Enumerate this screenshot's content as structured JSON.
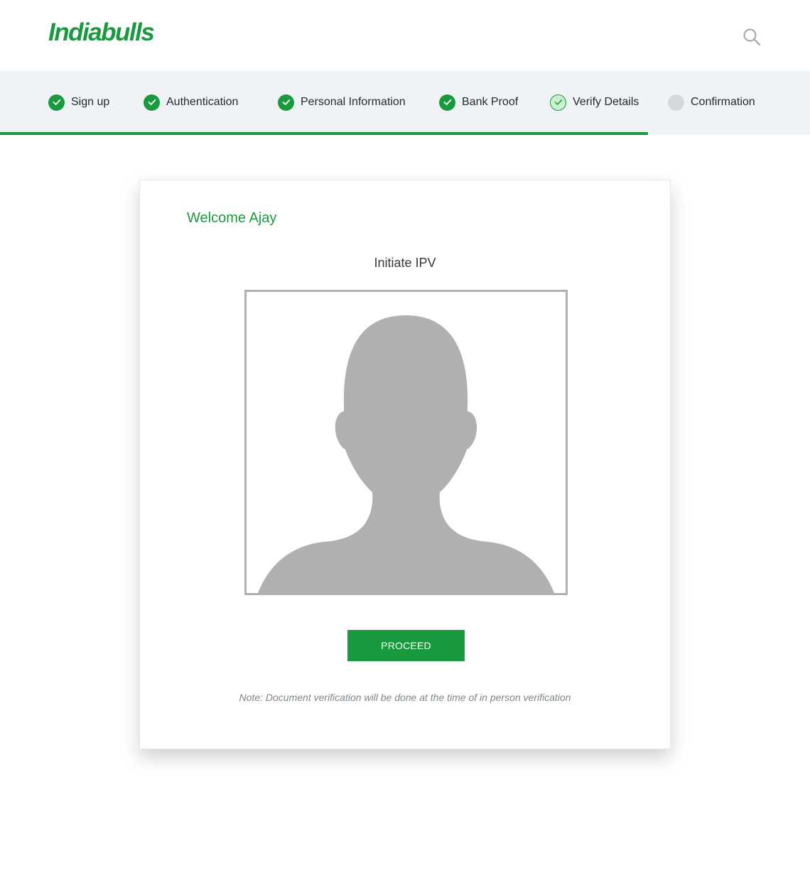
{
  "header": {
    "logo_text": "Indiabulls",
    "search_icon": "search-icon"
  },
  "stepper": {
    "steps": [
      {
        "label": "Sign up",
        "status": "done"
      },
      {
        "label": "Authentication",
        "status": "done"
      },
      {
        "label": "Personal Information",
        "status": "done"
      },
      {
        "label": "Bank Proof",
        "status": "done"
      },
      {
        "label": "Verify Details",
        "status": "current"
      },
      {
        "label": "Confirmation",
        "status": "pending"
      }
    ],
    "progress_fraction": 0.8
  },
  "card": {
    "welcome": "Welcome Ajay",
    "title": "Initiate IPV",
    "photo_placeholder_icon": "avatar-placeholder-icon",
    "proceed_label": "PROCEED",
    "note": "Note: Document verification will be done at the time of in person verification"
  },
  "colors": {
    "brand_green": "#1a9a3e",
    "stepper_bg": "#eff3f6",
    "pending_gray": "#d4d9de",
    "silhouette_gray": "#b0b0b0"
  }
}
